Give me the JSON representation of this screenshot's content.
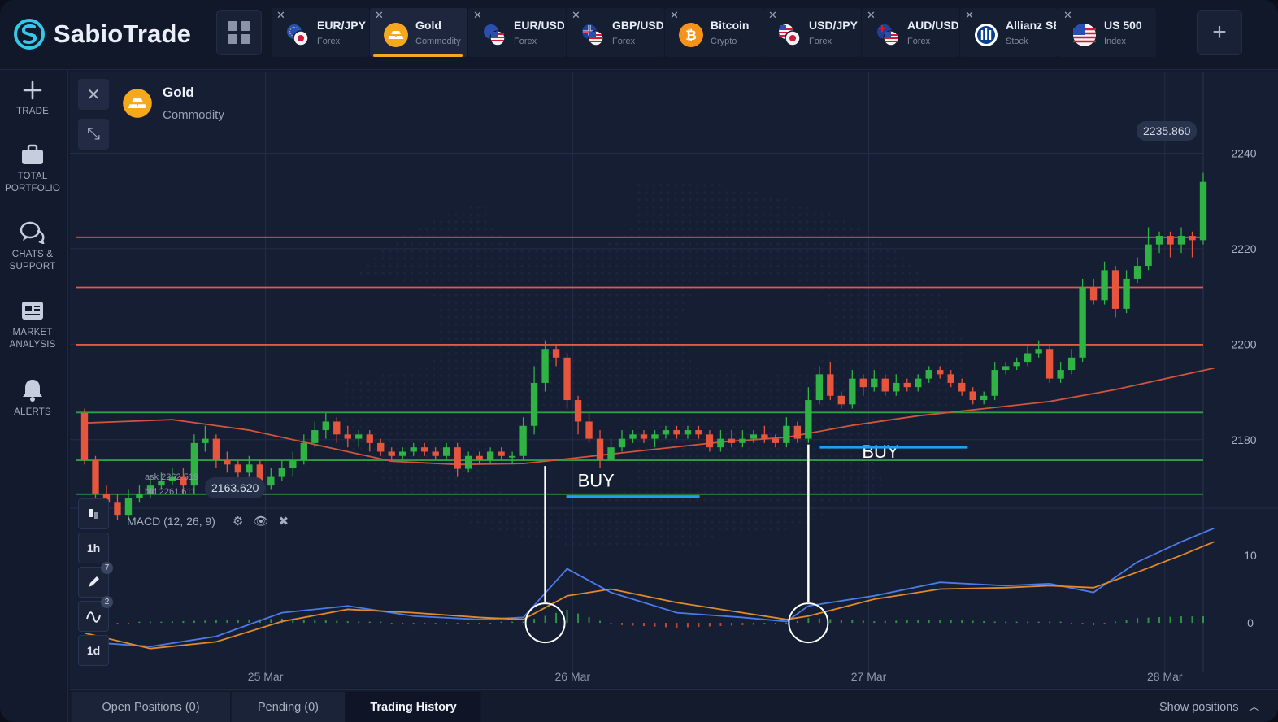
{
  "app": {
    "name": "SabioTrade",
    "add_tab_label": "+",
    "grid_icon": "grid-icon"
  },
  "tabs": [
    {
      "name": "EUR/JPY",
      "type": "Forex",
      "icon": "eu-jp-flags-icon"
    },
    {
      "name": "Gold",
      "type": "Commodity",
      "icon": "gold-bars-icon",
      "active": true
    },
    {
      "name": "EUR/USD",
      "type": "Forex",
      "icon": "eu-us-flags-icon"
    },
    {
      "name": "GBP/USD",
      "type": "Forex",
      "icon": "gb-us-flags-icon"
    },
    {
      "name": "Bitcoin",
      "type": "Crypto",
      "icon": "bitcoin-icon"
    },
    {
      "name": "USD/JPY",
      "type": "Forex",
      "icon": "us-jp-flags-icon"
    },
    {
      "name": "AUD/USD",
      "type": "Forex",
      "icon": "au-us-flags-icon"
    },
    {
      "name": "Allianz SE",
      "type": "Stock",
      "icon": "allianz-icon"
    },
    {
      "name": "US 500",
      "type": "Index",
      "icon": "us-flag-icon"
    }
  ],
  "sidebar": {
    "items": [
      {
        "label": "TRADE",
        "icon": "plus-icon"
      },
      {
        "label": "TOTAL PORTFOLIO",
        "icon": "briefcase-icon"
      },
      {
        "label": "CHATS & SUPPORT",
        "icon": "chat-bubbles-icon"
      },
      {
        "label": "MARKET ANALYSIS",
        "icon": "newspaper-icon"
      },
      {
        "label": "ALERTS",
        "icon": "bell-icon"
      }
    ]
  },
  "chart": {
    "asset_name": "Gold",
    "asset_type": "Commodity",
    "close_symbol": "✕",
    "collapse_symbol": "⤡",
    "price_tag_right": "2235.860",
    "price_tag_left": "2163.620",
    "ask": "ask 2262.519",
    "bid": "bid 2261.611",
    "macd_label": "MACD (12, 26, 9)",
    "timeframe_1h": "1h",
    "timeframe_1d": "1d",
    "draw_badge": "7",
    "indicator_badge": "2",
    "buy_labels": [
      "BUY",
      "BUY"
    ],
    "colors": {
      "up": "#2fb344",
      "down": "#e8553d",
      "resistance": "#e05a46",
      "support": "#2f9e44",
      "ma": "#d0553d",
      "macd": "#4b7be8",
      "signal": "#e18a2c",
      "buy_underline": "#1ea0f0"
    }
  },
  "chart_data": {
    "type": "candlestick",
    "title": "",
    "x_labels": [
      "25 Mar",
      "26 Mar",
      "27 Mar",
      "28 Mar"
    ],
    "y_ticks": [
      2180,
      2200,
      2220,
      2240
    ],
    "y_range": [
      2166,
      2252
    ],
    "resistance_levels": [
      2222.4,
      2211.9,
      2199.9
    ],
    "support_levels": [
      2185.7,
      2175.7,
      2168.6
    ],
    "macd_ticks": [
      0,
      10
    ],
    "macd_range": [
      -6,
      16
    ],
    "candles": [
      [
        2185.6,
        2175.7,
        2186.5,
        2174.8
      ],
      [
        2175.7,
        2168.6,
        2176.6,
        2167.7
      ],
      [
        2168.6,
        2166.8,
        2170.4,
        2165.0
      ],
      [
        2166.8,
        2164.1,
        2168.6,
        2163.2
      ],
      [
        2164.1,
        2167.7,
        2169.5,
        2163.2
      ],
      [
        2167.7,
        2168.6,
        2170.4,
        2166.8
      ],
      [
        2168.6,
        2170.4,
        2172.2,
        2167.7
      ],
      [
        2170.4,
        2171.3,
        2173.1,
        2169.5
      ],
      [
        2171.3,
        2172.2,
        2174.0,
        2170.4
      ],
      [
        2172.2,
        2170.4,
        2174.0,
        2168.6
      ],
      [
        2170.4,
        2179.3,
        2181.1,
        2168.6
      ],
      [
        2179.3,
        2180.2,
        2182.9,
        2177.5
      ],
      [
        2180.2,
        2175.7,
        2181.1,
        2174.0
      ],
      [
        2175.7,
        2174.8,
        2177.5,
        2173.1
      ],
      [
        2174.8,
        2173.1,
        2175.7,
        2171.3
      ],
      [
        2173.1,
        2174.8,
        2176.6,
        2172.2
      ],
      [
        2174.8,
        2170.4,
        2175.7,
        2169.5
      ],
      [
        2170.4,
        2172.2,
        2174.0,
        2169.5
      ],
      [
        2172.2,
        2174.0,
        2175.7,
        2171.3
      ],
      [
        2174.0,
        2175.7,
        2177.5,
        2172.2
      ],
      [
        2175.7,
        2179.3,
        2181.1,
        2174.8
      ],
      [
        2179.3,
        2182.0,
        2183.8,
        2178.4
      ],
      [
        2182.0,
        2183.8,
        2185.6,
        2180.2
      ],
      [
        2183.8,
        2181.1,
        2184.7,
        2179.3
      ],
      [
        2181.1,
        2180.2,
        2182.9,
        2178.4
      ],
      [
        2180.2,
        2181.1,
        2182.0,
        2178.4
      ],
      [
        2181.1,
        2179.3,
        2182.0,
        2177.5
      ],
      [
        2179.3,
        2177.5,
        2180.2,
        2176.6
      ],
      [
        2177.5,
        2176.6,
        2178.4,
        2175.7
      ],
      [
        2176.6,
        2177.5,
        2178.4,
        2175.7
      ],
      [
        2177.5,
        2178.4,
        2179.3,
        2176.6
      ],
      [
        2178.4,
        2177.5,
        2179.3,
        2176.6
      ],
      [
        2177.5,
        2176.6,
        2178.4,
        2175.7
      ],
      [
        2176.6,
        2178.4,
        2179.3,
        2175.7
      ],
      [
        2178.4,
        2173.9,
        2179.3,
        2172.2
      ],
      [
        2173.9,
        2176.6,
        2177.5,
        2173.1
      ],
      [
        2176.6,
        2175.7,
        2177.5,
        2174.8
      ],
      [
        2175.7,
        2177.5,
        2178.4,
        2174.8
      ],
      [
        2177.5,
        2176.6,
        2178.4,
        2175.7
      ],
      [
        2176.6,
        2176.6,
        2177.5,
        2174.8
      ],
      [
        2176.6,
        2182.9,
        2184.7,
        2175.7
      ],
      [
        2182.9,
        2191.9,
        2195.4,
        2181.1
      ],
      [
        2191.9,
        2199.0,
        2200.8,
        2190.1
      ],
      [
        2199.0,
        2197.2,
        2199.9,
        2195.4
      ],
      [
        2197.2,
        2188.3,
        2198.1,
        2186.5
      ],
      [
        2188.3,
        2183.8,
        2189.2,
        2181.1
      ],
      [
        2183.8,
        2180.2,
        2185.6,
        2179.3
      ],
      [
        2180.2,
        2175.7,
        2182.0,
        2174.0
      ],
      [
        2175.7,
        2178.4,
        2180.2,
        2175.7
      ],
      [
        2178.4,
        2180.2,
        2182.0,
        2177.5
      ],
      [
        2180.2,
        2181.1,
        2182.0,
        2179.3
      ],
      [
        2181.1,
        2180.2,
        2182.0,
        2179.3
      ],
      [
        2180.2,
        2181.1,
        2182.0,
        2178.4
      ],
      [
        2181.1,
        2182.0,
        2182.9,
        2180.2
      ],
      [
        2182.0,
        2181.1,
        2182.9,
        2180.2
      ],
      [
        2181.1,
        2182.0,
        2182.9,
        2180.2
      ],
      [
        2182.0,
        2181.1,
        2182.9,
        2180.2
      ],
      [
        2181.1,
        2178.4,
        2182.0,
        2177.5
      ],
      [
        2178.4,
        2180.2,
        2182.0,
        2177.5
      ],
      [
        2180.2,
        2179.3,
        2182.0,
        2178.4
      ],
      [
        2179.3,
        2180.2,
        2182.0,
        2178.4
      ],
      [
        2180.2,
        2181.1,
        2182.0,
        2179.3
      ],
      [
        2181.1,
        2180.2,
        2182.9,
        2179.3
      ],
      [
        2180.2,
        2179.3,
        2181.1,
        2178.4
      ],
      [
        2179.3,
        2182.9,
        2184.7,
        2178.4
      ],
      [
        2182.9,
        2180.2,
        2183.8,
        2179.3
      ],
      [
        2180.2,
        2188.3,
        2191.0,
        2179.3
      ],
      [
        2188.3,
        2193.7,
        2195.4,
        2187.4
      ],
      [
        2193.7,
        2189.2,
        2196.3,
        2188.3
      ],
      [
        2189.2,
        2187.4,
        2190.1,
        2186.5
      ],
      [
        2187.4,
        2192.8,
        2194.6,
        2186.5
      ],
      [
        2192.8,
        2191.0,
        2193.7,
        2189.2
      ],
      [
        2191.0,
        2192.8,
        2194.6,
        2190.1
      ],
      [
        2192.8,
        2190.1,
        2193.7,
        2189.2
      ],
      [
        2190.1,
        2191.9,
        2193.7,
        2189.2
      ],
      [
        2191.9,
        2191.0,
        2192.8,
        2190.1
      ],
      [
        2191.0,
        2192.8,
        2193.7,
        2190.1
      ],
      [
        2192.8,
        2194.6,
        2195.4,
        2191.9
      ],
      [
        2194.6,
        2193.7,
        2195.4,
        2192.8
      ],
      [
        2193.7,
        2191.9,
        2194.6,
        2191.0
      ],
      [
        2191.9,
        2190.1,
        2192.8,
        2189.2
      ],
      [
        2190.1,
        2188.3,
        2191.0,
        2187.4
      ],
      [
        2188.3,
        2189.2,
        2190.1,
        2187.4
      ],
      [
        2189.2,
        2194.6,
        2196.3,
        2188.3
      ],
      [
        2194.6,
        2195.4,
        2196.3,
        2193.7
      ],
      [
        2195.4,
        2196.3,
        2197.2,
        2194.6
      ],
      [
        2196.3,
        2198.1,
        2199.9,
        2195.4
      ],
      [
        2198.1,
        2199.0,
        2200.8,
        2197.2
      ],
      [
        2199.0,
        2192.8,
        2199.9,
        2191.9
      ],
      [
        2192.8,
        2194.6,
        2196.3,
        2191.9
      ],
      [
        2194.6,
        2197.2,
        2199.0,
        2193.7
      ],
      [
        2197.2,
        2211.9,
        2213.7,
        2196.3
      ],
      [
        2211.9,
        2209.2,
        2213.7,
        2208.3
      ],
      [
        2209.2,
        2215.5,
        2217.3,
        2208.3
      ],
      [
        2215.5,
        2207.4,
        2216.4,
        2205.6
      ],
      [
        2207.4,
        2213.7,
        2215.5,
        2206.5
      ],
      [
        2213.7,
        2216.4,
        2218.2,
        2212.8
      ],
      [
        2216.4,
        2220.9,
        2224.5,
        2215.5
      ],
      [
        2220.9,
        2222.7,
        2223.6,
        2219.1
      ],
      [
        2222.7,
        2220.9,
        2223.6,
        2218.2
      ],
      [
        2220.9,
        2222.7,
        2224.5,
        2219.1
      ],
      [
        2222.7,
        2221.8,
        2223.6,
        2218.2
      ],
      [
        2221.8,
        2234.0,
        2235.9,
        2220.9
      ]
    ],
    "moving_average": [
      [
        0,
        2183.5
      ],
      [
        8,
        2184.2
      ],
      [
        15,
        2182.0
      ],
      [
        22,
        2178.5
      ],
      [
        28,
        2175.5
      ],
      [
        34,
        2174.8
      ],
      [
        40,
        2175.0
      ],
      [
        46,
        2176.5
      ],
      [
        52,
        2178.0
      ],
      [
        58,
        2179.5
      ],
      [
        64,
        2180.5
      ],
      [
        70,
        2183.0
      ],
      [
        76,
        2185.0
      ],
      [
        82,
        2186.5
      ],
      [
        88,
        2188.0
      ],
      [
        94,
        2190.5
      ],
      [
        100,
        2193.5
      ],
      [
        103,
        2195.0
      ]
    ],
    "macd_line": [
      [
        0,
        -2.8
      ],
      [
        6,
        -3.5
      ],
      [
        12,
        -2.0
      ],
      [
        18,
        1.5
      ],
      [
        24,
        2.5
      ],
      [
        30,
        1.0
      ],
      [
        36,
        0.5
      ],
      [
        40,
        0.8
      ],
      [
        44,
        8.0
      ],
      [
        48,
        4.5
      ],
      [
        54,
        1.5
      ],
      [
        60,
        0.8
      ],
      [
        64,
        0.2
      ],
      [
        66,
        2.5
      ],
      [
        72,
        4.0
      ],
      [
        78,
        6.0
      ],
      [
        84,
        5.5
      ],
      [
        88,
        5.8
      ],
      [
        92,
        4.5
      ],
      [
        96,
        9.0
      ],
      [
        100,
        12.0
      ],
      [
        103,
        14.0
      ]
    ],
    "signal_line": [
      [
        0,
        -1.5
      ],
      [
        6,
        -3.8
      ],
      [
        12,
        -2.8
      ],
      [
        18,
        0.2
      ],
      [
        24,
        2.0
      ],
      [
        30,
        1.5
      ],
      [
        36,
        0.8
      ],
      [
        40,
        0.5
      ],
      [
        44,
        4.0
      ],
      [
        48,
        5.0
      ],
      [
        54,
        3.0
      ],
      [
        60,
        1.5
      ],
      [
        64,
        0.5
      ],
      [
        66,
        1.0
      ],
      [
        72,
        3.5
      ],
      [
        78,
        5.0
      ],
      [
        84,
        5.2
      ],
      [
        88,
        5.5
      ],
      [
        92,
        5.2
      ],
      [
        96,
        7.5
      ],
      [
        100,
        10.0
      ],
      [
        103,
        12.0
      ]
    ],
    "buy_signals": [
      {
        "candle": 42,
        "label": "BUY"
      },
      {
        "candle": 66,
        "label": "BUY"
      }
    ]
  },
  "bottom": {
    "tabs": [
      "Open Positions (0)",
      "Pending (0)",
      "Trading History"
    ],
    "active_tab": "Trading History",
    "show_positions": "Show positions"
  }
}
